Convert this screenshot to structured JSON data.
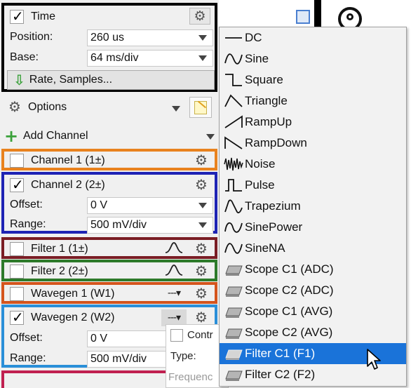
{
  "time": {
    "title": "Time",
    "position_label": "Position:",
    "position_value": "260 us",
    "base_label": "Base:",
    "base_value": "64 ms/div",
    "rate_button": "Rate, Samples..."
  },
  "options": {
    "label": "Options"
  },
  "add_channel": {
    "label": "Add Channel"
  },
  "channels": [
    {
      "label": "Channel 1 (1±)",
      "checked": false,
      "color": "#e8821e"
    },
    {
      "label": "Channel 2 (2±)",
      "checked": true,
      "color": "#1e23b4",
      "offset_label": "Offset:",
      "offset_value": "0 V",
      "range_label": "Range:",
      "range_value": "500 mV/div"
    }
  ],
  "filters": [
    {
      "label": "Filter 1 (1±)",
      "checked": false,
      "color": "#7a1d24"
    },
    {
      "label": "Filter 2 (2±)",
      "checked": false,
      "color": "#2d7a2a"
    }
  ],
  "wavegens": [
    {
      "label": "Wavegen 1 (W1)",
      "checked": false,
      "color": "#d4541c"
    },
    {
      "label": "Wavegen 2 (W2)",
      "checked": true,
      "color": "#2a8fd8",
      "offset_label": "Offset:",
      "offset_value": "0 V",
      "range_label": "Range:",
      "range_value": "500 mV/div"
    }
  ],
  "wave_dropdown_symbol": "---▾",
  "popup": {
    "contr": "Contr",
    "type": "Type:",
    "freq": "Frequenc"
  },
  "menu": {
    "items": [
      {
        "label": "DC",
        "icon": "dc-line-icon"
      },
      {
        "label": "Sine",
        "icon": "sine-wave-icon"
      },
      {
        "label": "Square",
        "icon": "square-wave-icon"
      },
      {
        "label": "Triangle",
        "icon": "triangle-wave-icon"
      },
      {
        "label": "RampUp",
        "icon": "ramp-up-icon"
      },
      {
        "label": "RampDown",
        "icon": "ramp-down-icon"
      },
      {
        "label": "Noise",
        "icon": "noise-icon"
      },
      {
        "label": "Pulse",
        "icon": "pulse-icon"
      },
      {
        "label": "Trapezium",
        "icon": "trapezium-icon"
      },
      {
        "label": "SinePower",
        "icon": "sine-power-icon"
      },
      {
        "label": "SineNA",
        "icon": "sine-na-icon"
      },
      {
        "label": "Scope C1 (ADC)",
        "icon": "scope-icon"
      },
      {
        "label": "Scope C2 (ADC)",
        "icon": "scope-icon"
      },
      {
        "label": "Scope C1 (AVG)",
        "icon": "scope-icon"
      },
      {
        "label": "Scope C2 (AVG)",
        "icon": "scope-icon"
      },
      {
        "label": "Filter C1 (F1)",
        "icon": "scope-icon",
        "selected": true
      },
      {
        "label": "Filter C2 (F2)",
        "icon": "scope-icon"
      }
    ]
  }
}
